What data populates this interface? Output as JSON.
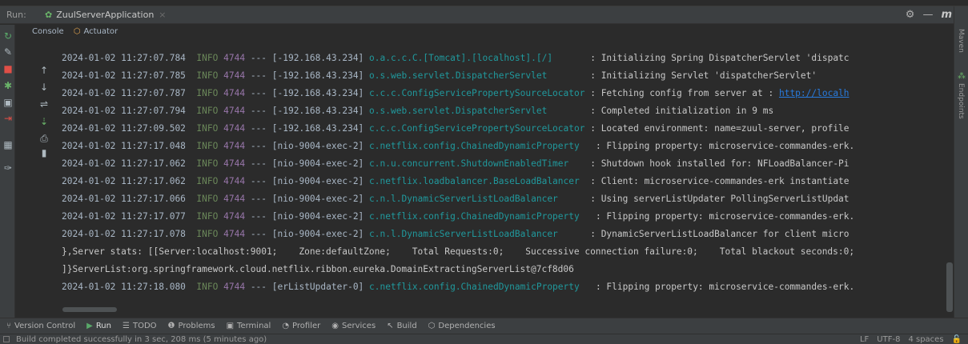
{
  "runbar": {
    "label": "Run:",
    "tab_label": "ZuulServerApplication",
    "close_glyph": "×",
    "right_icons": [
      "gear-icon",
      "minimize-icon"
    ],
    "right_letter": "m"
  },
  "subtabs": [
    {
      "label": "Console",
      "icon": "console-icon"
    },
    {
      "label": "Actuator",
      "icon": "actuator-icon"
    }
  ],
  "left_toolbar": [
    {
      "icon": "rerun-icon",
      "glyph": "↻",
      "color": "#59a869"
    },
    {
      "icon": "wrench-icon",
      "glyph": "🔧",
      "color": "#aeb9c0"
    },
    {
      "icon": "stop-icon",
      "glyph": "■",
      "color": "#e04f47"
    },
    {
      "icon": "debug-icon",
      "glyph": "✱",
      "color": "#6ab469"
    },
    {
      "icon": "camera-icon",
      "glyph": "▣",
      "color": "#aeb9c0"
    },
    {
      "icon": "exit-icon",
      "glyph": "⇥",
      "color": "#e04f47"
    },
    {
      "icon": "layout-icon",
      "glyph": "▦",
      "color": "#aeb9c0"
    },
    {
      "icon": "pin-icon",
      "glyph": "✑",
      "color": "#aeb9c0"
    }
  ],
  "console_toolbar": [
    {
      "icon": "up-arrow-icon",
      "glyph": "↑"
    },
    {
      "icon": "down-arrow-icon",
      "glyph": "↓"
    },
    {
      "icon": "soft-wrap-icon",
      "glyph": "⇌"
    },
    {
      "icon": "scroll-to-end-icon",
      "glyph": "⇣"
    },
    {
      "icon": "print-icon",
      "glyph": "⎙"
    },
    {
      "icon": "trash-icon",
      "glyph": "▮"
    }
  ],
  "log_lines": [
    {
      "ts": "2024-01-02 11:27:07.784",
      "level": "INFO",
      "pid": "4744",
      "sep": "---",
      "thread": "[-192.168.43.234]",
      "logger": "o.a.c.c.C.[Tomcat].[localhost].[/]      ",
      "msg": ": Initializing Spring DispatcherServlet 'dispatc"
    },
    {
      "ts": "2024-01-02 11:27:07.785",
      "level": "INFO",
      "pid": "4744",
      "sep": "---",
      "thread": "[-192.168.43.234]",
      "logger": "o.s.web.servlet.DispatcherServlet       ",
      "msg": ": Initializing Servlet 'dispatcherServlet'"
    },
    {
      "ts": "2024-01-02 11:27:07.787",
      "level": "INFO",
      "pid": "4744",
      "sep": "---",
      "thread": "[-192.168.43.234]",
      "logger": "c.c.c.ConfigServicePropertySourceLocator",
      "msg": ": Fetching config from server at : ",
      "link": "http://localh"
    },
    {
      "ts": "2024-01-02 11:27:07.794",
      "level": "INFO",
      "pid": "4744",
      "sep": "---",
      "thread": "[-192.168.43.234]",
      "logger": "o.s.web.servlet.DispatcherServlet       ",
      "msg": ": Completed initialization in 9 ms"
    },
    {
      "ts": "2024-01-02 11:27:09.502",
      "level": "INFO",
      "pid": "4744",
      "sep": "---",
      "thread": "[-192.168.43.234]",
      "logger": "c.c.c.ConfigServicePropertySourceLocator",
      "msg": ": Located environment: name=zuul-server, profile"
    },
    {
      "ts": "2024-01-02 11:27:17.048",
      "level": "INFO",
      "pid": "4744",
      "sep": "---",
      "thread": "[nio-9004-exec-2]",
      "logger": "c.netflix.config.ChainedDynamicProperty  ",
      "msg": ": Flipping property: microservice-commandes-erk."
    },
    {
      "ts": "2024-01-02 11:27:17.062",
      "level": "INFO",
      "pid": "4744",
      "sep": "---",
      "thread": "[nio-9004-exec-2]",
      "logger": "c.n.u.concurrent.ShutdownEnabledTimer   ",
      "msg": ": Shutdown hook installed for: NFLoadBalancer-Pi"
    },
    {
      "ts": "2024-01-02 11:27:17.062",
      "level": "INFO",
      "pid": "4744",
      "sep": "---",
      "thread": "[nio-9004-exec-2]",
      "logger": "c.netflix.loadbalancer.BaseLoadBalancer ",
      "msg": ": Client: microservice-commandes-erk instantiate"
    },
    {
      "ts": "2024-01-02 11:27:17.066",
      "level": "INFO",
      "pid": "4744",
      "sep": "---",
      "thread": "[nio-9004-exec-2]",
      "logger": "c.n.l.DynamicServerListLoadBalancer     ",
      "msg": ": Using serverListUpdater PollingServerListUpdat"
    },
    {
      "ts": "2024-01-02 11:27:17.077",
      "level": "INFO",
      "pid": "4744",
      "sep": "---",
      "thread": "[nio-9004-exec-2]",
      "logger": "c.netflix.config.ChainedDynamicProperty  ",
      "msg": ": Flipping property: microservice-commandes-erk."
    },
    {
      "ts": "2024-01-02 11:27:17.078",
      "level": "INFO",
      "pid": "4744",
      "sep": "---",
      "thread": "[nio-9004-exec-2]",
      "logger": "c.n.l.DynamicServerListLoadBalancer     ",
      "msg": ": DynamicServerListLoadBalancer for client micro"
    }
  ],
  "continuation_lines": [
    "},Server stats: [[Server:localhost:9001;    Zone:defaultZone;    Total Requests:0;    Successive connection failure:0;    Total blackout seconds:0;",
    "]}ServerList:org.springframework.cloud.netflix.ribbon.eureka.DomainExtractingServerList@7cf8d06"
  ],
  "last_line": {
    "ts": "2024-01-02 11:27:18.080",
    "level": "INFO",
    "pid": "4744",
    "sep": "---",
    "thread": "[erListUpdater-0]",
    "logger": "c.netflix.config.ChainedDynamicProperty  ",
    "msg": ": Flipping property: microservice-commandes-erk."
  },
  "right_rail": [
    "Maven",
    "Endpoints"
  ],
  "bottom_tabs": [
    {
      "label": "Version Control",
      "icon": "vcs-icon",
      "glyph": "⑂"
    },
    {
      "label": "Run",
      "icon": "run-icon",
      "glyph": "▶"
    },
    {
      "label": "TODO",
      "icon": "todo-icon",
      "glyph": "☰"
    },
    {
      "label": "Problems",
      "icon": "problems-icon",
      "glyph": "❶"
    },
    {
      "label": "Terminal",
      "icon": "terminal-icon",
      "glyph": "▣"
    },
    {
      "label": "Profiler",
      "icon": "profiler-icon",
      "glyph": "◔"
    },
    {
      "label": "Services",
      "icon": "services-icon",
      "glyph": "◉"
    },
    {
      "label": "Build",
      "icon": "build-icon",
      "glyph": "↖"
    },
    {
      "label": "Dependencies",
      "icon": "dependencies-icon",
      "glyph": "⬡"
    }
  ],
  "status": {
    "message": "Build completed successfully in 3 sec, 208 ms (5 minutes ago)",
    "line_sep": "LF",
    "encoding": "UTF-8",
    "indent": "4 spaces"
  },
  "colors": {
    "background": "#2b2b2b",
    "panel": "#3c3f41",
    "info": "#6a8759",
    "pid": "#9876aa",
    "logger": "#20999d",
    "link": "#287bde"
  }
}
